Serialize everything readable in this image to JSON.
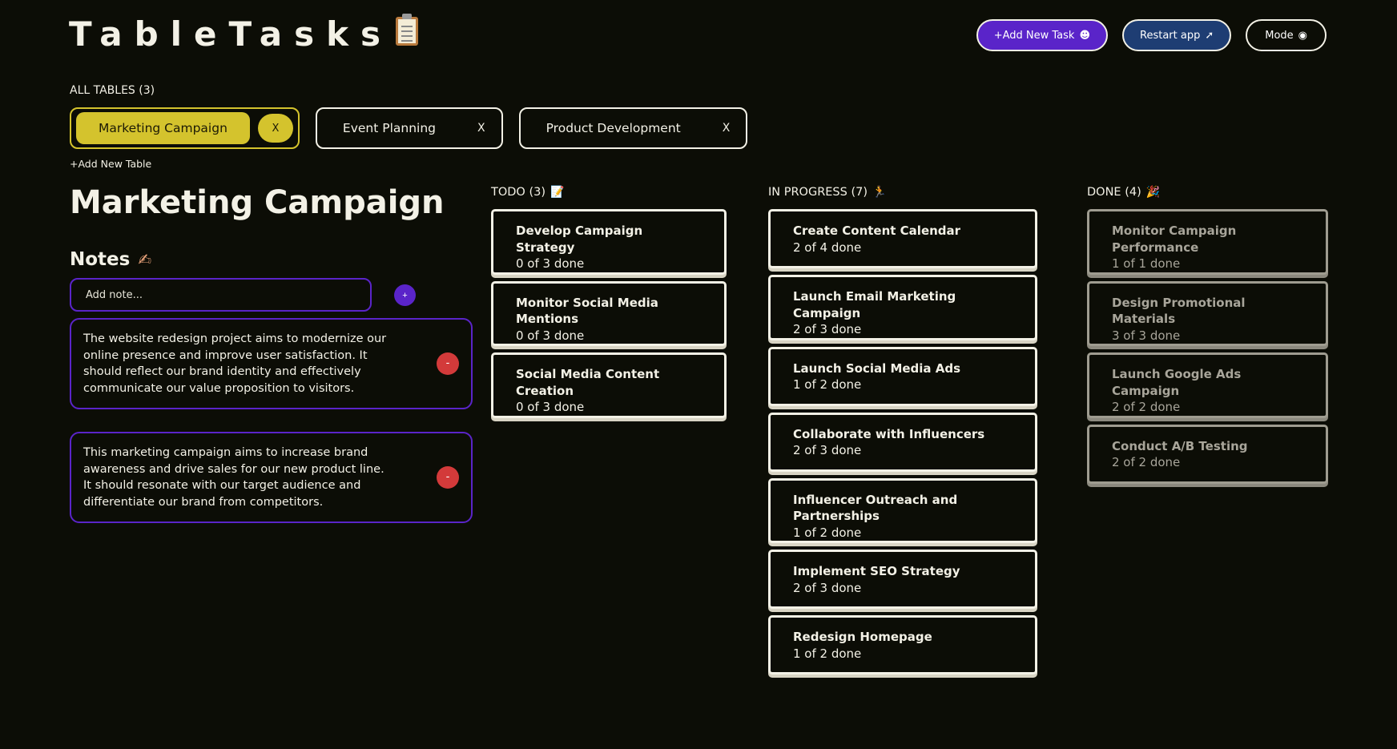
{
  "app": {
    "title": "TableTasks",
    "logo_icon": "clipboard-icon"
  },
  "header": {
    "add_task_label": "+Add New Task",
    "add_task_icon": "smiley-icon",
    "restart_label": "Restart app",
    "restart_icon": "rocket-icon",
    "mode_label": "Mode",
    "mode_icon": "globe-icon"
  },
  "tables": {
    "heading": "ALL TABLES (3)",
    "items": [
      {
        "label": "Marketing Campaign",
        "close": "X",
        "active": true
      },
      {
        "label": "Event Planning",
        "close": "X",
        "active": false
      },
      {
        "label": "Product Development",
        "close": "X",
        "active": false
      }
    ],
    "add_label": "+Add New Table"
  },
  "current": {
    "title": "Marketing Campaign"
  },
  "notes": {
    "heading": "Notes",
    "heading_icon": "writing-hand-icon",
    "input_placeholder": "Add note...",
    "add_button": "+",
    "delete_button": "-",
    "items": [
      "The website redesign project aims to modernize our online presence and improve user satisfaction. It should reflect our brand identity and effectively communicate our value proposition to visitors.",
      "This marketing campaign aims to increase brand awareness and drive sales for our new product line. It should resonate with our target audience and differentiate our brand from competitors."
    ]
  },
  "columns": {
    "todo": {
      "heading": "TODO (3)",
      "icon": "memo-icon",
      "cards": [
        {
          "title": "Develop Campaign Strategy",
          "progress": "0 of 3 done"
        },
        {
          "title": "Monitor Social Media Mentions",
          "progress": "0 of 3 done"
        },
        {
          "title": "Social Media Content Creation",
          "progress": "0 of 3 done"
        }
      ]
    },
    "in_progress": {
      "heading": "IN PROGRESS (7)",
      "icon": "running-person-icon",
      "cards": [
        {
          "title": "Create Content Calendar",
          "progress": "2 of 4 done"
        },
        {
          "title": "Launch Email Marketing Campaign",
          "progress": "2 of 3 done"
        },
        {
          "title": "Launch Social Media Ads",
          "progress": "1 of 2 done"
        },
        {
          "title": "Collaborate with Influencers",
          "progress": "2 of 3 done"
        },
        {
          "title": "Influencer Outreach and Partnerships",
          "progress": "1 of 2 done"
        },
        {
          "title": "Implement SEO Strategy",
          "progress": "2 of 3 done"
        },
        {
          "title": "Redesign Homepage",
          "progress": "1 of 2 done"
        }
      ]
    },
    "done": {
      "heading": "DONE (4)",
      "icon": "party-popper-icon",
      "cards": [
        {
          "title": "Monitor Campaign Performance",
          "progress": "1 of 1 done"
        },
        {
          "title": "Design Promotional Materials",
          "progress": "3 of 3 done"
        },
        {
          "title": "Launch Google Ads Campaign",
          "progress": "2 of 2 done"
        },
        {
          "title": "Conduct A/B Testing",
          "progress": "2 of 2 done"
        }
      ]
    }
  },
  "colors": {
    "background": "#0c0d06",
    "accent_yellow": "#d4c32d",
    "accent_purple": "#5a24c9",
    "accent_blue": "#1e3d73",
    "delete_red": "#d33a3a"
  }
}
